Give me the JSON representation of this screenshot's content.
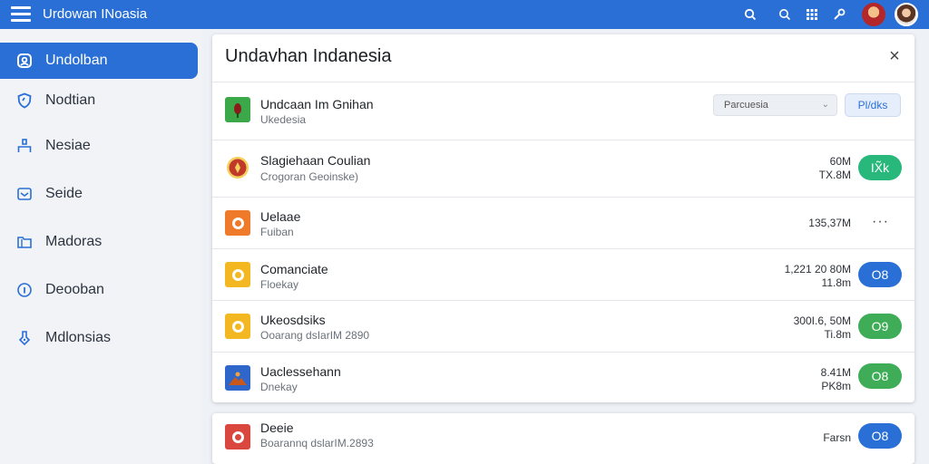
{
  "app": {
    "title": "Urdowan INoasia"
  },
  "topbar": {
    "icons": [
      "search-icon",
      "zoom-icon",
      "apps-grid-icon",
      "wrench-icon"
    ]
  },
  "sidebar": {
    "items": [
      {
        "label": "Undolban",
        "icon": "home-icon",
        "active": true
      },
      {
        "label": "Nodtian",
        "icon": "shield-icon"
      },
      {
        "label": "Nesiae",
        "icon": "person-icon"
      },
      {
        "label": "Seide",
        "icon": "mail-icon"
      },
      {
        "label": "Madoras",
        "icon": "folder-icon"
      },
      {
        "label": "Deooban",
        "icon": "info-icon"
      },
      {
        "label": "Mdlonsias",
        "icon": "tag-icon"
      }
    ]
  },
  "panel": {
    "title": "Undavhan Indanesia",
    "close_symbol": "×",
    "filter": {
      "value": "Parcuesia"
    },
    "top_button": "Pl/dks",
    "rows": [
      {
        "title": "Undcaan Im Gnihan",
        "subtitle": "Ukedesia",
        "icon": "app-green-icon",
        "icon_color": "#3ba84a"
      },
      {
        "title": "Slagiehaan Coulian",
        "subtitle": "Crogoran Geoinske)",
        "meta1": "60M",
        "meta2": "TX.8M",
        "action": "IX̃k",
        "action_color": "#28b87c",
        "icon": "emblem-icon",
        "icon_color": "#c0392b"
      },
      {
        "title": "Uelaae",
        "subtitle": "Fuiban",
        "meta1": "135,37M",
        "meta2": "",
        "action": "···",
        "icon": "circle-orange-icon",
        "icon_color": "#ee7a2a"
      },
      {
        "title": "Comanciate",
        "subtitle": "Floekay",
        "meta1": "1,221 20 80M",
        "meta2": "11.8m",
        "action": "O8",
        "action_color": "#2a6fd6",
        "icon": "circle-yellow-icon",
        "icon_color": "#f3b721"
      },
      {
        "title": "Ukeosdsiks",
        "subtitle": "Ooarang dsIarIM 2890",
        "meta1": "300I.6, 50M",
        "meta2": "Ti.8m",
        "action": "O9",
        "action_color": "#3fad57",
        "icon": "circle-yellow2-icon",
        "icon_color": "#f3b721"
      },
      {
        "title": "Uaclessehann",
        "subtitle": "Dnekay",
        "meta1": "8.41M",
        "meta2": "PK8m",
        "action": "O8",
        "action_color": "#3fad57",
        "icon": "landscape-icon",
        "icon_color": "#2f66c9"
      }
    ]
  },
  "card2": {
    "row": {
      "title": "Deeie",
      "subtitle": "Boarannq dslarIM.2893",
      "meta1": "Farsn",
      "action": "O8",
      "action_color": "#2a6fd6",
      "icon": "circle-red-icon",
      "icon_color": "#d9473f"
    }
  }
}
